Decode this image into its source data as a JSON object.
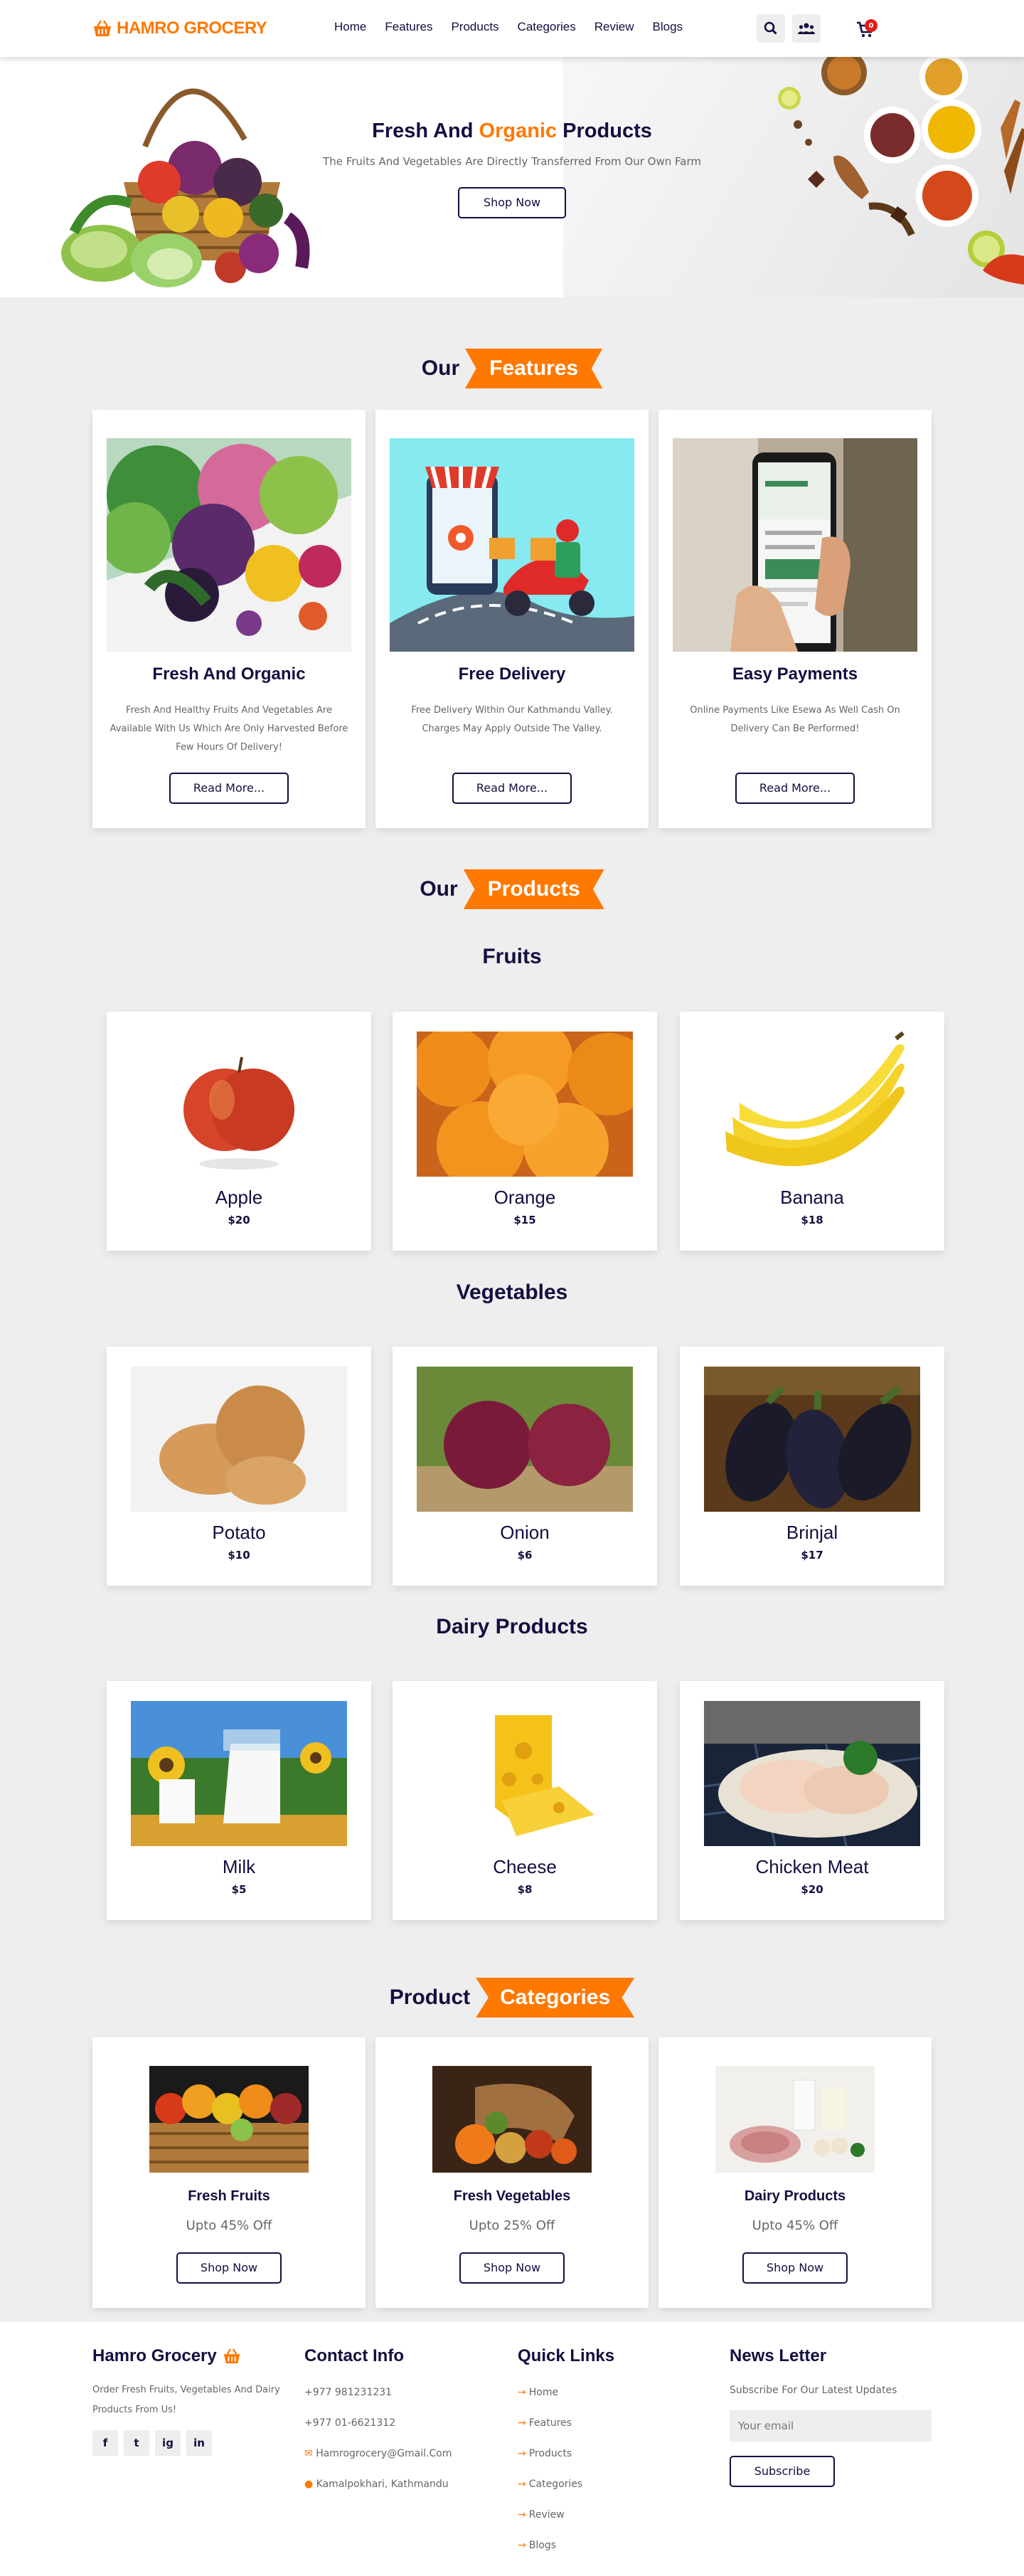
{
  "header": {
    "logo_text": "HAMRO GROCERY",
    "nav": [
      "Home",
      "Features",
      "Products",
      "Categories",
      "Review",
      "Blogs"
    ],
    "cart_count": "0",
    "icons": [
      "search-icon",
      "users-icon",
      "cart-icon"
    ]
  },
  "hero": {
    "title_pre": "Fresh And",
    "title_accent": "Organic",
    "title_post": "Products",
    "subtitle": "The Fruits And Vegetables Are Directly Transferred From Our Own Farm",
    "button": "Shop Now"
  },
  "features": {
    "heading_pre": "Our",
    "heading_tag": "Features",
    "cards": [
      {
        "title": "Fresh And Organic",
        "desc": "Fresh And Healthy Fruits And Vegetables Are Available With Us Which Are Only Harvested Before Few Hours Of Delivery!",
        "button": "Read More..."
      },
      {
        "title": "Free Delivery",
        "desc": "Free Delivery Within Our Kathmandu Valley. Charges May Apply Outside The Valley.",
        "button": "Read More..."
      },
      {
        "title": "Easy Payments",
        "desc": "Online Payments Like Esewa As Well Cash On Delivery Can Be Performed!",
        "button": "Read More..."
      }
    ]
  },
  "products": {
    "heading_pre": "Our",
    "heading_tag": "Products",
    "groups": [
      {
        "title": "Fruits",
        "items": [
          {
            "name": "Apple",
            "price": "$20"
          },
          {
            "name": "Orange",
            "price": "$15"
          },
          {
            "name": "Banana",
            "price": "$18"
          }
        ]
      },
      {
        "title": "Vegetables",
        "items": [
          {
            "name": "Potato",
            "price": "$10"
          },
          {
            "name": "Onion",
            "price": "$6"
          },
          {
            "name": "Brinjal",
            "price": "$17"
          }
        ]
      },
      {
        "title": "Dairy Products",
        "items": [
          {
            "name": "Milk",
            "price": "$5"
          },
          {
            "name": "Cheese",
            "price": "$8"
          },
          {
            "name": "Chicken Meat",
            "price": "$20"
          }
        ]
      }
    ]
  },
  "categories": {
    "heading_pre": "Product",
    "heading_tag": "Categories",
    "cards": [
      {
        "title": "Fresh Fruits",
        "discount": "Upto 45% Off",
        "button": "Shop Now"
      },
      {
        "title": "Fresh Vegetables",
        "discount": "Upto 25% Off",
        "button": "Shop Now"
      },
      {
        "title": "Dairy Products",
        "discount": "Upto 45% Off",
        "button": "Shop Now"
      }
    ]
  },
  "footer": {
    "brand": "Hamro Grocery",
    "brand_desc": "Order Fresh Fruits, Vegetables And Dairy Products From Us!",
    "social": [
      "f",
      "t",
      "ig",
      "in"
    ],
    "contact_title": "Contact Info",
    "phone1": "+977 981231231",
    "phone2": "+977 01-6621312",
    "email": "Hamrogrocery@Gmail.Com",
    "address": "Kamalpokhari, Kathmandu",
    "links_title": "Quick Links",
    "links": [
      "Home",
      "Features",
      "Products",
      "Categories",
      "Review",
      "Blogs"
    ],
    "news_title": "News Letter",
    "news_desc": "Subscribe For Our Latest Updates",
    "email_placeholder": "Your email",
    "subscribe": "Subscribe"
  },
  "colors": {
    "accent": "#ff7800",
    "dark": "#130f40",
    "bg": "#eeeeee"
  }
}
